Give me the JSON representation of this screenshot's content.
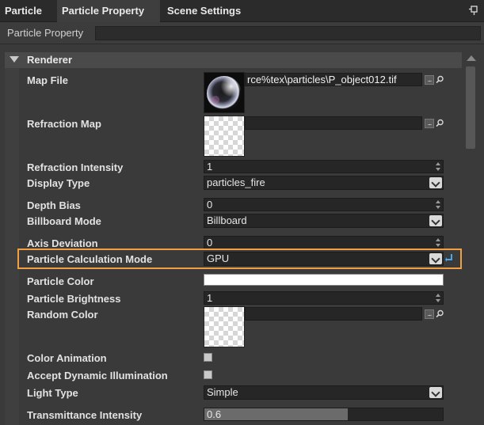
{
  "tabs": [
    {
      "label": "Particle"
    },
    {
      "label": "Particle Property"
    },
    {
      "label": "Scene Settings"
    }
  ],
  "panel_title": "Particle Property",
  "section": {
    "title": "Renderer"
  },
  "properties": {
    "map_file": {
      "label": "Map File",
      "value": "rce%tex\\particles\\P_object012.tif",
      "browse": "..."
    },
    "refraction_map": {
      "label": "Refraction Map",
      "value": "",
      "browse": "..."
    },
    "refraction_intensity": {
      "label": "Refraction Intensity",
      "value": "1"
    },
    "display_type": {
      "label": "Display Type",
      "value": "particles_fire"
    },
    "depth_bias": {
      "label": "Depth Bias",
      "value": "0"
    },
    "billboard_mode": {
      "label": "Billboard Mode",
      "value": "Billboard"
    },
    "axis_deviation": {
      "label": "Axis Deviation",
      "value": "0"
    },
    "particle_calculation_mode": {
      "label": "Particle Calculation Mode",
      "value": "GPU"
    },
    "particle_color": {
      "label": "Particle Color",
      "color": "#ffffff"
    },
    "particle_brightness": {
      "label": "Particle Brightness",
      "value": "1"
    },
    "random_color": {
      "label": "Random Color",
      "value": "",
      "browse": "..."
    },
    "color_animation": {
      "label": "Color Animation",
      "checked": false
    },
    "accept_dynamic_illumination": {
      "label": "Accept Dynamic Illumination",
      "checked": false
    },
    "light_type": {
      "label": "Light Type",
      "value": "Simple"
    },
    "transmittance_intensity": {
      "label": "Transmittance Intensity",
      "value": "0.6",
      "level": 0.6
    }
  },
  "colors": {
    "highlight": "#f0a040",
    "reset_icon": "#4aa8e8",
    "background": "#3a3a3a"
  }
}
